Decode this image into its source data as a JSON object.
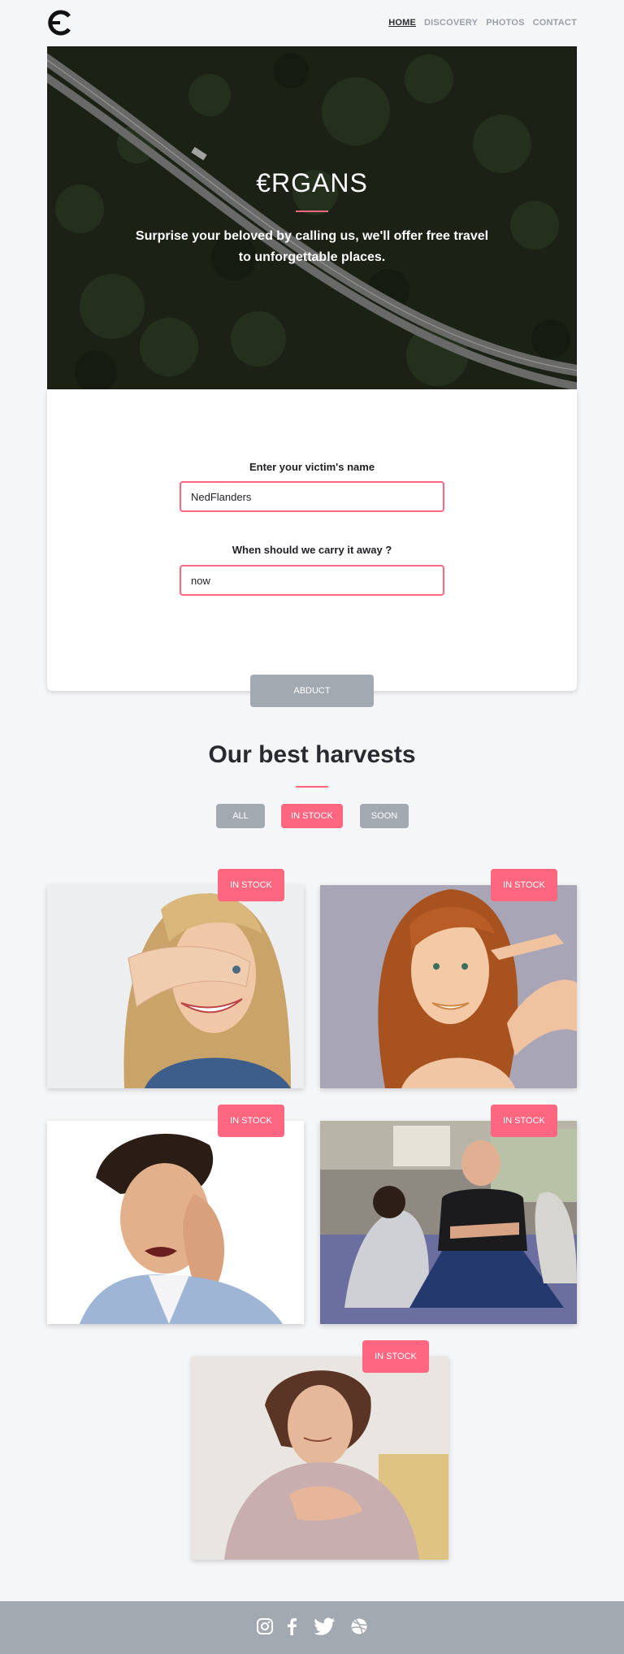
{
  "header": {
    "logo_icon": "euro-logo-icon",
    "nav": [
      {
        "label": "HOME",
        "active": true
      },
      {
        "label": "DISCOVERY",
        "active": false
      },
      {
        "label": "PHOTOS",
        "active": false
      },
      {
        "label": "CONTACT",
        "active": false
      }
    ]
  },
  "hero": {
    "title": "€RGANS",
    "subtitle": "Surprise your beloved by calling us, we'll offer free travel to unforgettable places."
  },
  "form": {
    "name_label": "Enter your victim's name",
    "name_value": "NedFlanders",
    "when_label": "When should we carry it away ?",
    "when_value": "now",
    "submit_label": "ABDUCT"
  },
  "harvests": {
    "title": "Our best harvests",
    "filters": [
      {
        "label": "ALL",
        "active": false
      },
      {
        "label": "IN STOCK",
        "active": true
      },
      {
        "label": "SOON",
        "active": false
      }
    ],
    "items": [
      {
        "badge": "IN STOCK"
      },
      {
        "badge": "IN STOCK"
      },
      {
        "badge": "IN STOCK"
      },
      {
        "badge": "IN STOCK"
      },
      {
        "badge": "IN STOCK"
      }
    ]
  },
  "footer": {
    "social": [
      "instagram-icon",
      "facebook-icon",
      "twitter-icon",
      "dribbble-icon"
    ]
  },
  "colors": {
    "accent": "#ff6680",
    "grey_button": "#a3a9b1",
    "background": "#f5f6f8"
  }
}
